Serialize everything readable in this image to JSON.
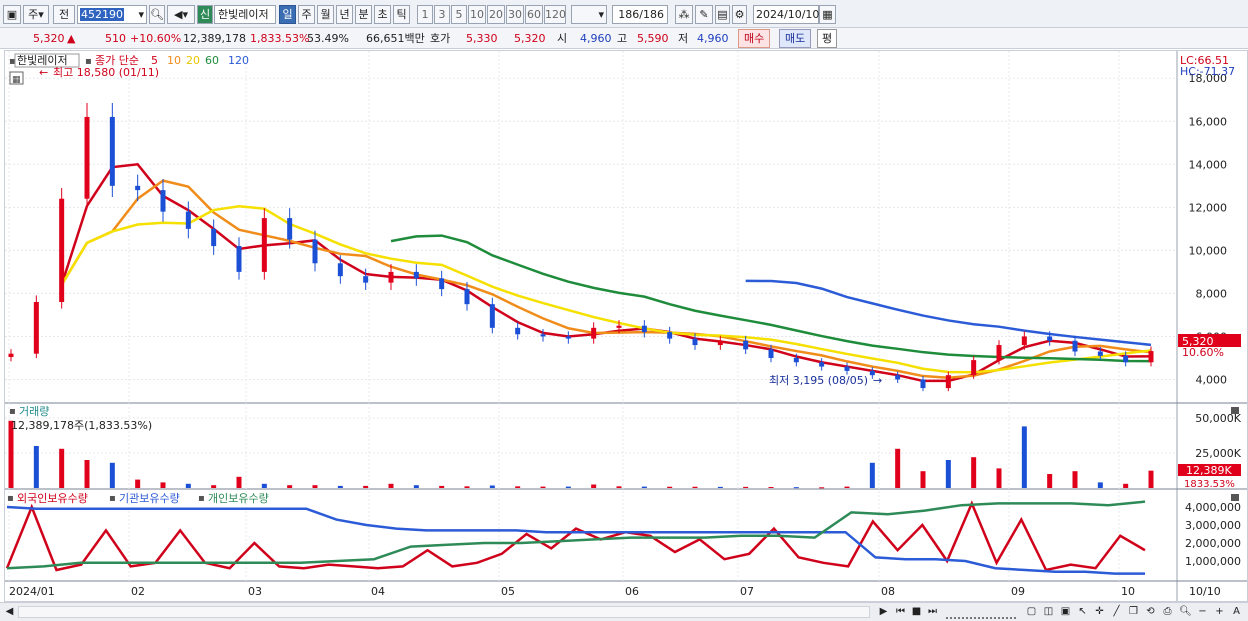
{
  "toolbar": {
    "period_select": "주",
    "prev_label": "전",
    "stock_code": "452190",
    "new_badge": "신",
    "stock_name": "한빛레이저",
    "intervals": [
      "일",
      "주",
      "월",
      "년",
      "분",
      "초",
      "틱"
    ],
    "active_interval": "일",
    "minute_presets": [
      "1",
      "3",
      "5",
      "10",
      "20",
      "30",
      "60",
      "120"
    ],
    "count_display": "186/186",
    "date_value": "2024/10/10"
  },
  "infobar": {
    "price": "5,320",
    "change": "510",
    "change_pct": "+10.60%",
    "volume": "12,389,178",
    "volume_pct": "1,833.53%",
    "turnover": "53.49%",
    "amount": "66,651백만",
    "quote_label": "호가",
    "ask": "5,330",
    "bid": "5,320",
    "open_label": "시",
    "open": "4,960",
    "high_label": "고",
    "high": "5,590",
    "low_label": "저",
    "low": "4,960",
    "buy_label": "매수",
    "sell_label": "매도",
    "avg_label": "평"
  },
  "price_panel": {
    "stock_tag": "한빛레이저",
    "ma_title": "종가 단순",
    "ma_periods": [
      "5",
      "10",
      "20",
      "60",
      "120"
    ],
    "ma_colors": [
      "#d0021b",
      "#f08c1a",
      "#f5e000",
      "#1e8c3a",
      "#2b5bd6"
    ],
    "high_annotation": "최고 18,580 (01/11)",
    "low_annotation": "최저 3,195 (08/05)",
    "lc_label": "LC:66.51",
    "hc_label": "HC:-71.37",
    "price_tag": "5,320",
    "pct_tag": "10.60%",
    "y_ticks": [
      "18,000",
      "16,000",
      "14,000",
      "12,000",
      "10,000",
      "8,000",
      "6,000",
      "4,000"
    ]
  },
  "volume_panel": {
    "title": "거래량",
    "subtitle": "12,389,178주(1,833.53%)",
    "y_ticks": [
      "50,000K",
      "25,000K"
    ],
    "volume_tag": "12,389K",
    "pct_tag": "1833.53%"
  },
  "holding_panel": {
    "series_names": [
      "외국인보유수량",
      "기관보유수량",
      "개인보유수량"
    ],
    "series_colors": [
      "#d0021b",
      "#2b5bd6",
      "#2e8b57"
    ],
    "y_ticks": [
      "4,000,000",
      "3,000,000",
      "2,000,000",
      "1,000,000"
    ]
  },
  "x_axis": {
    "labels": [
      "2024/01",
      "02",
      "03",
      "04",
      "05",
      "06",
      "07",
      "08",
      "09",
      "10"
    ],
    "right_label": "10/10"
  },
  "chart_data": [
    {
      "type": "candlestick",
      "title": "한빛레이저",
      "ylim": [
        3000,
        18800
      ],
      "x": [
        "2024/01",
        "02",
        "03",
        "04",
        "05",
        "06",
        "07",
        "08",
        "09",
        "10"
      ],
      "close": [
        5200,
        7600,
        12400,
        16200,
        13000,
        12800,
        11800,
        11000,
        10200,
        9000,
        11500,
        10500,
        9400,
        8800,
        8500,
        9000,
        8700,
        8200,
        7500,
        6400,
        6100,
        6000,
        5900,
        6400,
        6500,
        6200,
        5900,
        5600,
        5800,
        5400,
        5000,
        4800,
        4600,
        4400,
        4200,
        4000,
        3600,
        4200,
        4900,
        5600,
        6000,
        5800,
        5300,
        5100,
        4800,
        5320
      ],
      "high": 18580,
      "low": 3195,
      "last": 5320
    },
    {
      "type": "bar",
      "title": "거래량",
      "ylim": [
        0,
        55000
      ],
      "values": [
        48000,
        30000,
        28000,
        20000,
        18000,
        6000,
        4000,
        3000,
        2000,
        8000,
        3000,
        2000,
        2000,
        1500,
        1500,
        3000,
        2000,
        1500,
        1200,
        1800,
        1200,
        1000,
        1000,
        2500,
        1200,
        1000,
        900,
        900,
        800,
        800,
        700,
        600,
        500,
        1000,
        18000,
        28000,
        12000,
        20000,
        22000,
        14000,
        44000,
        10000,
        12000,
        4000,
        3000,
        12389
      ]
    },
    {
      "type": "line",
      "ylim": [
        0,
        4500000
      ],
      "series": [
        {
          "name": "외국인보유수량",
          "values": [
            600000,
            4000000,
            500000,
            800000,
            2700000,
            700000,
            900000,
            2700000,
            900000,
            600000,
            2000000,
            700000,
            600000,
            800000,
            700000,
            600000,
            700000,
            1600000,
            700000,
            900000,
            1400000,
            2500000,
            1700000,
            2800000,
            2200000,
            2600000,
            2400000,
            1500000,
            2200000,
            1100000,
            1400000,
            2800000,
            1200000,
            900000,
            700000,
            3200000,
            1600000,
            3000000,
            1000000,
            4200000,
            900000,
            3300000,
            500000,
            800000,
            600000,
            2400000,
            1600000
          ]
        },
        {
          "name": "기관보유수량",
          "values": [
            4000000,
            3900000,
            3900000,
            3900000,
            3900000,
            3900000,
            3900000,
            3900000,
            3900000,
            3900000,
            3900000,
            3300000,
            3000000,
            2800000,
            2700000,
            2700000,
            2700000,
            2700000,
            2600000,
            2600000,
            2600000,
            2600000,
            2600000,
            2600000,
            2600000,
            2600000,
            2600000,
            2600000,
            2600000,
            1200000,
            1100000,
            1100000,
            1000000,
            600000,
            500000,
            400000,
            400000,
            300000,
            300000
          ]
        },
        {
          "name": "개인보유수량",
          "values": [
            600000,
            700000,
            900000,
            900000,
            900000,
            900000,
            900000,
            900000,
            900000,
            1000000,
            1100000,
            1800000,
            1900000,
            2000000,
            2000000,
            2100000,
            2200000,
            2300000,
            2300000,
            2300000,
            2400000,
            2400000,
            2300000,
            3700000,
            3600000,
            3800000,
            4100000,
            4200000,
            4200000,
            4200000,
            4100000,
            4300000
          ]
        }
      ]
    }
  ]
}
